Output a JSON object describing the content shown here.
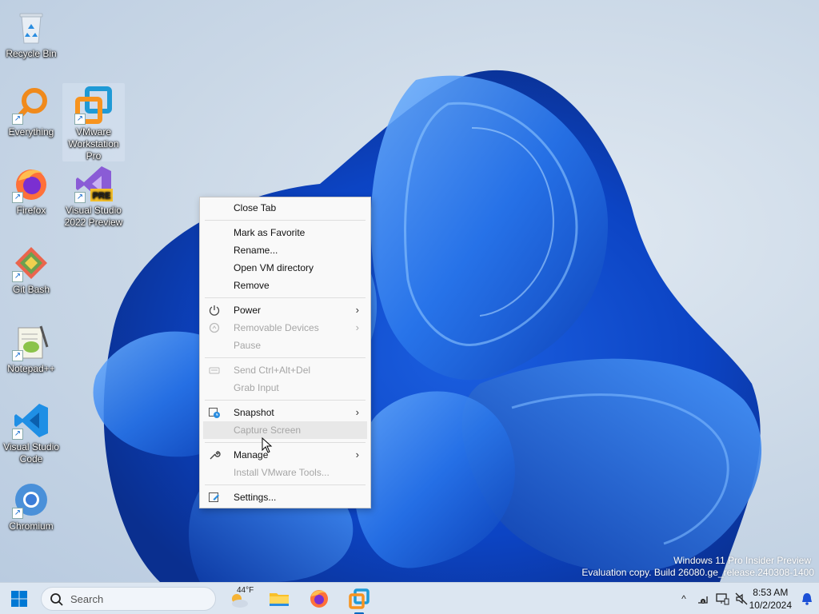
{
  "desktop": {
    "icons": [
      {
        "label": "Recycle Bin",
        "icon": "recycle-bin-icon"
      },
      {
        "label": "Everything",
        "icon": "everything-search-icon"
      },
      {
        "label": "VMware Workstation Pro",
        "icon": "vmware-icon"
      },
      {
        "label": "Firefox",
        "icon": "firefox-icon"
      },
      {
        "label": "Visual Studio 2022 Preview",
        "icon": "visual-studio-icon",
        "badge": "PRE"
      },
      {
        "label": "Git Bash",
        "icon": "git-bash-icon"
      },
      {
        "label": "Notepad++",
        "icon": "notepad-plus-plus-icon"
      },
      {
        "label": "Visual Studio Code",
        "icon": "vscode-icon"
      },
      {
        "label": "Chromium",
        "icon": "chromium-icon"
      }
    ]
  },
  "context_menu": {
    "items": [
      {
        "label": "Close Tab",
        "enabled": true
      },
      {
        "label": "Mark as Favorite",
        "enabled": true
      },
      {
        "label": "Rename...",
        "enabled": true
      },
      {
        "label": "Open VM directory",
        "enabled": true
      },
      {
        "label": "Remove",
        "enabled": true
      },
      {
        "label": "Power",
        "enabled": true,
        "icon": "power-icon",
        "submenu": true
      },
      {
        "label": "Removable Devices",
        "enabled": false,
        "icon": "removable-devices-icon",
        "submenu": true
      },
      {
        "label": "Pause",
        "enabled": false
      },
      {
        "label": "Send Ctrl+Alt+Del",
        "enabled": false,
        "icon": "keyboard-icon"
      },
      {
        "label": "Grab Input",
        "enabled": false
      },
      {
        "label": "Snapshot",
        "enabled": true,
        "icon": "snapshot-icon",
        "submenu": true
      },
      {
        "label": "Capture Screen",
        "enabled": false,
        "hovered": true
      },
      {
        "label": "Manage",
        "enabled": true,
        "icon": "wrench-icon",
        "submenu": true
      },
      {
        "label": "Install VMware Tools...",
        "enabled": false
      },
      {
        "label": "Settings...",
        "enabled": true,
        "icon": "settings-icon"
      }
    ],
    "submenu_arrow": "›"
  },
  "watermark": {
    "line1": "Windows 11 Pro Insider Preview",
    "line2": "Evaluation copy. Build 26080.ge_release.240308-1400"
  },
  "taskbar": {
    "search_placeholder": "Search",
    "weather_temp": "44°F",
    "pinned": [
      "weather-icon",
      "file-explorer-icon",
      "firefox-icon",
      "vmware-icon"
    ],
    "tray": {
      "time": "8:53 AM",
      "date": "10/2/2024"
    }
  },
  "colors": {
    "accent": "#0067c0",
    "bloom_dark": "#0a3fb8",
    "bloom_light": "#3d8cf5"
  }
}
